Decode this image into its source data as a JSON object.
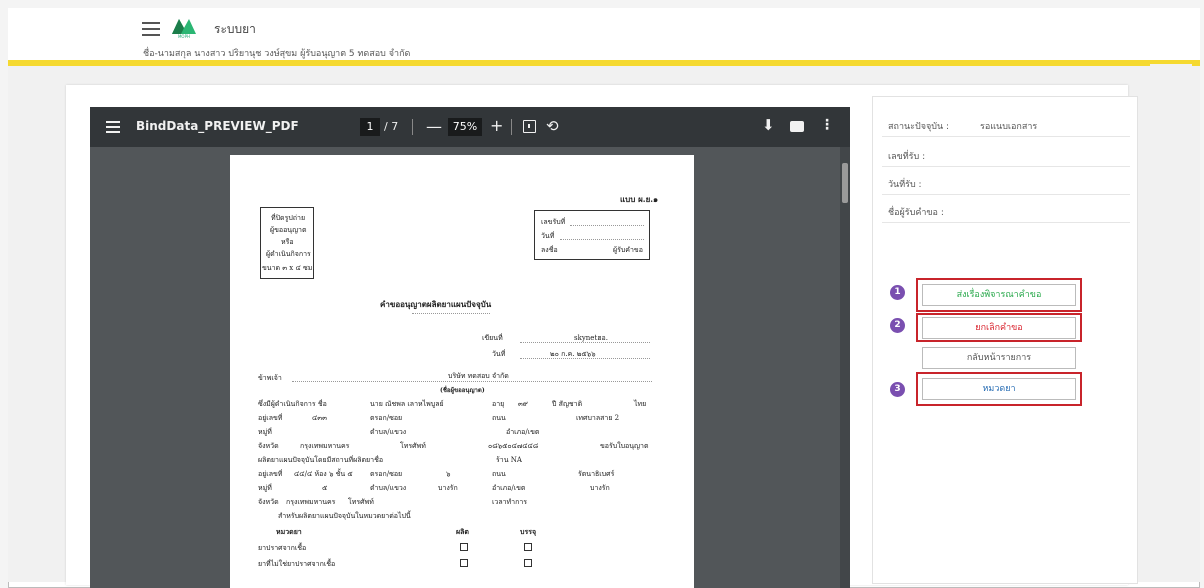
{
  "header": {
    "app_title": "ระบบยา",
    "logo_text": "MOPH",
    "user_line": "ชื่อ-นามสกุล นางสาว ปริยานุช วงษ์สุขม ผู้รับอนุญาต 5 ทดสอบ จำกัด"
  },
  "pdf_viewer": {
    "title": "BindData_PREVIEW_PDF",
    "current_page": "1",
    "total_pages": "/ 7",
    "zoom": "75%",
    "minus": "—",
    "plus": "+",
    "rotate_glyph": "⟲",
    "download_glyph": "⬇",
    "more_glyph": "⋮"
  },
  "document": {
    "form_code": "แบบ ผ.ย.๑",
    "photo_box": [
      "ที่ปิดรูปถ่าย",
      "ผู้ขออนุญาต",
      "หรือ",
      "ผู้ดำเนินกิจการ",
      "ขนาด ๓ x ๔ ซม."
    ],
    "recv_box": {
      "recv_no": "เลขรับที่",
      "date": "วันที่",
      "sign": "ลงชื่อ",
      "receiver": "ผู้รับคำขอ"
    },
    "heading": "คำขออนุญาตผลิตยาแผนปัจจุบัน",
    "written_at_label": "เขียนที่",
    "written_at_value": "skynetฮอ.",
    "date_label": "วันที่",
    "date_value": "๒๐ ก.ค. ๒๕๖๖",
    "i_label": "ข้าพเจ้า",
    "company": "บริษัท ทดสอบ จำกัด",
    "company_note": "(ชื่อผู้ขออนุญาต)",
    "operator_label": "ซึ่งมีผู้ดำเนินกิจการ ชื่อ",
    "operator_name": "นาย ณัชพล เลาหไพบูลย์",
    "age_label": "อายุ",
    "age_value": "๓๙",
    "nationality_label": "ปี สัญชาติ",
    "nationality_value": "ไทย",
    "address_no_label": "อยู่เลขที่",
    "address_no": "๔๓๓",
    "lane_label": "ตรอก/ซอย",
    "road_label": "ถนน",
    "road_value": "เทศบาลสาย 2",
    "moo_label": "หมู่ที่",
    "subdistrict_label": "ตำบล/แขวง",
    "district_label": "อำเภอ/เขต",
    "province_label": "จังหวัด",
    "province_value": "กรุงเทพมหานคร",
    "phone_label": "โทรศัพท์",
    "phone_value": "๐๘๖๕๐๔๗๔๔๘",
    "request_label": "ขอรับใบอนุญาต",
    "produce_label": "ผลิตยาแผนปัจจุบันโดยมีสถานที่ผลิตยาชื่อ",
    "shop_label": "ร้าน NA",
    "address2_no_label": "อยู่เลขที่",
    "address2_no": "๔๔/๔ ห้อง ๖ ชั้น ๕",
    "lane2_label": "ตรอก/ซอย",
    "lane2_value": "๖",
    "road2_label": "ถนน",
    "road2_value": "รัตนาธิเบศร์",
    "moo2_label": "หมู่ที่",
    "moo2_value": "๕",
    "subdistrict2_label": "ตำบล/แขวง",
    "subdistrict2_value": "บางรัก",
    "district2_label": "อำเภอ/เขต",
    "district2_value": "บางรัก",
    "province2_label": "จังหวัด",
    "province2_value": "กรุงเทพมหานคร",
    "phone2_label": "โทรศัพท์",
    "hours_label": "เวลาทำการ",
    "for_label": "สำหรับผลิตยาแผนปัจจุบันในหมวดยาต่อไปนี้",
    "col_category": "หมวดยา",
    "col_produce": "ผลิต",
    "col_pack": "บรรจุ",
    "rows": [
      "ยาปราศจากเชื้อ",
      "ยาที่ไม่ใช่ยาปราศจากเชื้อ"
    ]
  },
  "status_panel": {
    "status_label": "สถานะปัจจุบัน :",
    "status_value": "รอแนบเอกสาร",
    "recv_no_label": "เลขที่รับ :",
    "recv_date_label": "วันที่รับ :",
    "receiver_label": "ชื่อผู้รับคำขอ :"
  },
  "actions": {
    "submit_label": "ส่งเรื่องพิจารณาคำขอ",
    "cancel_label": "ยกเลิกคำขอ",
    "back_label": "กลับหน้ารายการ",
    "drug_category_label": "หมวดยา",
    "badge1": "1",
    "badge2": "2",
    "badge3": "3"
  },
  "colors": {
    "accent_yellow": "#f5d930",
    "highlight_red": "#c8242b",
    "badge_purple": "#7a4fb0",
    "submit_green": "#27a84a",
    "cancel_red": "#d9232e",
    "drug_blue": "#2b6fb5"
  }
}
